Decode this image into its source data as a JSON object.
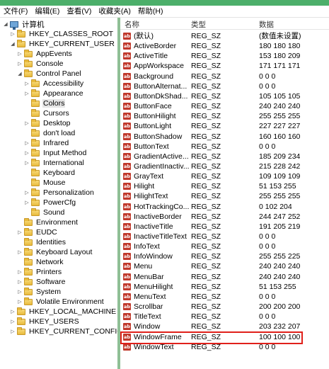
{
  "menu": [
    "文件(F)",
    "编辑(E)",
    "查看(V)",
    "收藏夹(A)",
    "帮助(H)"
  ],
  "tree": [
    {
      "label": "计算机",
      "exp": "◢",
      "icon": "computer",
      "indent": 0
    },
    {
      "label": "HKEY_CLASSES_ROOT",
      "exp": "▷",
      "icon": "folder",
      "indent": 1
    },
    {
      "label": "HKEY_CURRENT_USER",
      "exp": "◢",
      "icon": "folder",
      "indent": 1
    },
    {
      "label": "AppEvents",
      "exp": "▷",
      "icon": "folder",
      "indent": 2
    },
    {
      "label": "Console",
      "exp": "▷",
      "icon": "folder",
      "indent": 2
    },
    {
      "label": "Control Panel",
      "exp": "◢",
      "icon": "folder",
      "indent": 2
    },
    {
      "label": "Accessibility",
      "exp": "▷",
      "icon": "folder",
      "indent": 3
    },
    {
      "label": "Appearance",
      "exp": "▷",
      "icon": "folder",
      "indent": 3
    },
    {
      "label": "Colors",
      "exp": "",
      "icon": "folder",
      "indent": 3,
      "selected": true
    },
    {
      "label": "Cursors",
      "exp": "",
      "icon": "folder",
      "indent": 3
    },
    {
      "label": "Desktop",
      "exp": "▷",
      "icon": "folder",
      "indent": 3
    },
    {
      "label": "don't load",
      "exp": "",
      "icon": "folder",
      "indent": 3
    },
    {
      "label": "Infrared",
      "exp": "▷",
      "icon": "folder",
      "indent": 3
    },
    {
      "label": "Input Method",
      "exp": "▷",
      "icon": "folder",
      "indent": 3
    },
    {
      "label": "International",
      "exp": "▷",
      "icon": "folder",
      "indent": 3
    },
    {
      "label": "Keyboard",
      "exp": "",
      "icon": "folder",
      "indent": 3
    },
    {
      "label": "Mouse",
      "exp": "",
      "icon": "folder",
      "indent": 3
    },
    {
      "label": "Personalization",
      "exp": "▷",
      "icon": "folder",
      "indent": 3
    },
    {
      "label": "PowerCfg",
      "exp": "▷",
      "icon": "folder",
      "indent": 3
    },
    {
      "label": "Sound",
      "exp": "",
      "icon": "folder",
      "indent": 3
    },
    {
      "label": "Environment",
      "exp": "",
      "icon": "folder",
      "indent": 2
    },
    {
      "label": "EUDC",
      "exp": "▷",
      "icon": "folder",
      "indent": 2
    },
    {
      "label": "Identities",
      "exp": "",
      "icon": "folder",
      "indent": 2
    },
    {
      "label": "Keyboard Layout",
      "exp": "▷",
      "icon": "folder",
      "indent": 2
    },
    {
      "label": "Network",
      "exp": "",
      "icon": "folder",
      "indent": 2
    },
    {
      "label": "Printers",
      "exp": "▷",
      "icon": "folder",
      "indent": 2
    },
    {
      "label": "Software",
      "exp": "▷",
      "icon": "folder",
      "indent": 2
    },
    {
      "label": "System",
      "exp": "▷",
      "icon": "folder",
      "indent": 2
    },
    {
      "label": "Volatile Environment",
      "exp": "▷",
      "icon": "folder",
      "indent": 2
    },
    {
      "label": "HKEY_LOCAL_MACHINE",
      "exp": "▷",
      "icon": "folder",
      "indent": 1
    },
    {
      "label": "HKEY_USERS",
      "exp": "▷",
      "icon": "folder",
      "indent": 1
    },
    {
      "label": "HKEY_CURRENT_CONFIG",
      "exp": "▷",
      "icon": "folder",
      "indent": 1
    }
  ],
  "columns": {
    "name": "名称",
    "type": "类型",
    "data": "数据"
  },
  "values": [
    {
      "name": "(默认)",
      "type": "REG_SZ",
      "data": "(数值未设置)"
    },
    {
      "name": "ActiveBorder",
      "type": "REG_SZ",
      "data": "180 180 180"
    },
    {
      "name": "ActiveTitle",
      "type": "REG_SZ",
      "data": "153 180 209"
    },
    {
      "name": "AppWorkspace",
      "type": "REG_SZ",
      "data": "171 171 171"
    },
    {
      "name": "Background",
      "type": "REG_SZ",
      "data": "0 0 0"
    },
    {
      "name": "ButtonAlternat...",
      "type": "REG_SZ",
      "data": "0 0 0"
    },
    {
      "name": "ButtonDkShad...",
      "type": "REG_SZ",
      "data": "105 105 105"
    },
    {
      "name": "ButtonFace",
      "type": "REG_SZ",
      "data": "240 240 240"
    },
    {
      "name": "ButtonHilight",
      "type": "REG_SZ",
      "data": "255 255 255"
    },
    {
      "name": "ButtonLight",
      "type": "REG_SZ",
      "data": "227 227 227"
    },
    {
      "name": "ButtonShadow",
      "type": "REG_SZ",
      "data": "160 160 160"
    },
    {
      "name": "ButtonText",
      "type": "REG_SZ",
      "data": "0 0 0"
    },
    {
      "name": "GradientActive...",
      "type": "REG_SZ",
      "data": "185 209 234"
    },
    {
      "name": "GradientInactiv...",
      "type": "REG_SZ",
      "data": "215 228 242"
    },
    {
      "name": "GrayText",
      "type": "REG_SZ",
      "data": "109 109 109"
    },
    {
      "name": "Hilight",
      "type": "REG_SZ",
      "data": "51 153 255"
    },
    {
      "name": "HilightText",
      "type": "REG_SZ",
      "data": "255 255 255"
    },
    {
      "name": "HotTrackingCo...",
      "type": "REG_SZ",
      "data": "0 102 204"
    },
    {
      "name": "InactiveBorder",
      "type": "REG_SZ",
      "data": "244 247 252"
    },
    {
      "name": "InactiveTitle",
      "type": "REG_SZ",
      "data": "191 205 219"
    },
    {
      "name": "InactiveTitleText",
      "type": "REG_SZ",
      "data": "0 0 0"
    },
    {
      "name": "InfoText",
      "type": "REG_SZ",
      "data": "0 0 0"
    },
    {
      "name": "InfoWindow",
      "type": "REG_SZ",
      "data": "255 255 225"
    },
    {
      "name": "Menu",
      "type": "REG_SZ",
      "data": "240 240 240"
    },
    {
      "name": "MenuBar",
      "type": "REG_SZ",
      "data": "240 240 240"
    },
    {
      "name": "MenuHilight",
      "type": "REG_SZ",
      "data": "51 153 255"
    },
    {
      "name": "MenuText",
      "type": "REG_SZ",
      "data": "0 0 0"
    },
    {
      "name": "Scrollbar",
      "type": "REG_SZ",
      "data": "200 200 200"
    },
    {
      "name": "TitleText",
      "type": "REG_SZ",
      "data": "0 0 0"
    },
    {
      "name": "Window",
      "type": "REG_SZ",
      "data": "203 232 207"
    },
    {
      "name": "WindowFrame",
      "type": "REG_SZ",
      "data": "100 100 100"
    },
    {
      "name": "WindowText",
      "type": "REG_SZ",
      "data": "0 0 0"
    }
  ],
  "colors": {
    "highlight_border": "#e0201a",
    "value_icon": "#c0392b",
    "window_accent": "#8fbf95"
  },
  "icons": {
    "value": "string-value-icon",
    "key": "folder-icon",
    "root": "computer-icon"
  }
}
